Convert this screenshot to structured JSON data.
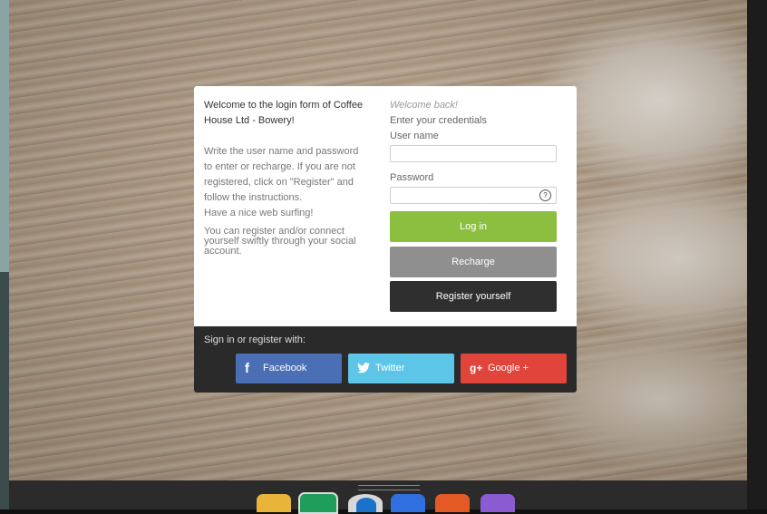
{
  "login_card": {
    "welcome_title": "Welcome to the login form of Coffee House Ltd - Bowery!",
    "instructions": "Write the user name and password to enter or recharge. If you are not registered, click on \"Register\" and follow the instructions.",
    "nice_surfing": "Have a nice web surfing!",
    "social_note": "You can register and/or connect yourself swiftly through your social account.",
    "welcome_back": "Welcome back!",
    "enter_credentials": "Enter your credentials",
    "username_label": "User name",
    "username_value": "",
    "password_label": "Password",
    "password_value": "",
    "help_icon": "?",
    "login_button": "Log in",
    "recharge_button": "Recharge",
    "register_button": "Register yourself"
  },
  "social": {
    "label": "Sign in or register with:",
    "buttons": [
      {
        "icon": "f",
        "label": "Facebook",
        "color": "#4a6fb5"
      },
      {
        "icon": "twitter-bird",
        "label": "Twitter",
        "color": "#5dc6e8"
      },
      {
        "icon": "g+",
        "label": "Google +",
        "color": "#e0443a"
      }
    ]
  },
  "dock": {
    "icons": [
      "folder-icon",
      "messages-icon",
      "browser-icon",
      "app-store-icon",
      "music-icon",
      "calendar-icon"
    ]
  },
  "colors": {
    "login": "#8cbf3f",
    "recharge": "#8f8f8f",
    "register": "#2f2f2f",
    "social_panel": "#2a2a2a"
  }
}
